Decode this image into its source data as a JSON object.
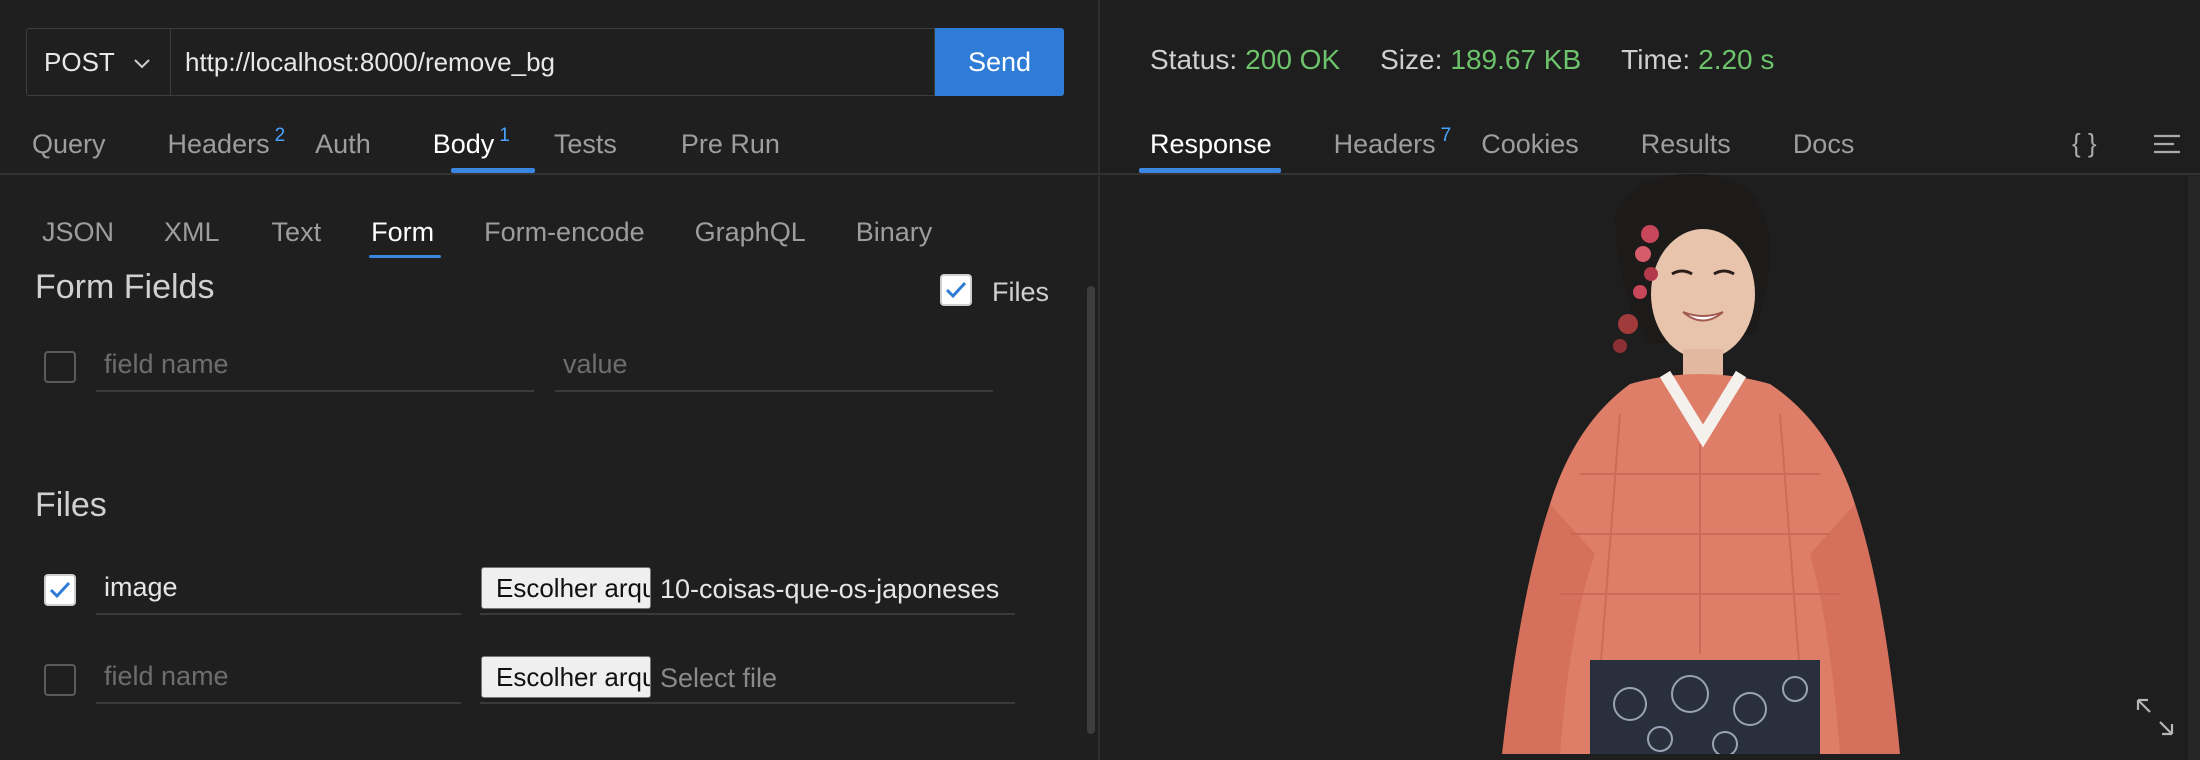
{
  "request": {
    "method": "POST",
    "url": "http://localhost:8000/remove_bg",
    "send_label": "Send",
    "tabs": [
      {
        "label": "Query",
        "badge": ""
      },
      {
        "label": "Headers",
        "badge": "2"
      },
      {
        "label": "Auth",
        "badge": ""
      },
      {
        "label": "Body",
        "badge": "1"
      },
      {
        "label": "Tests",
        "badge": ""
      },
      {
        "label": "Pre Run",
        "badge": ""
      }
    ],
    "active_tab": "Body",
    "body_tabs": [
      "JSON",
      "XML",
      "Text",
      "Form",
      "Form-encode",
      "GraphQL",
      "Binary"
    ],
    "active_body_tab": "Form",
    "form_fields": {
      "title": "Form Fields",
      "files_toggle_label": "Files",
      "files_toggle_checked": true,
      "rows": [
        {
          "checked": false,
          "name_placeholder": "field name",
          "value_placeholder": "value"
        }
      ]
    },
    "files": {
      "title": "Files",
      "rows": [
        {
          "checked": true,
          "name": "image",
          "button_label": "Escolher arquivo",
          "file_name": "10-coisas-que-os-japoneses"
        },
        {
          "checked": false,
          "name_placeholder": "field name",
          "button_label": "Escolher arquivo",
          "file_placeholder": "Select file"
        }
      ]
    }
  },
  "response": {
    "status_label": "Status:",
    "status_value": "200 OK",
    "size_label": "Size:",
    "size_value": "189.67 KB",
    "time_label": "Time:",
    "time_value": "2.20 s",
    "tabs": [
      {
        "label": "Response",
        "badge": ""
      },
      {
        "label": "Headers",
        "badge": "7"
      },
      {
        "label": "Cookies",
        "badge": ""
      },
      {
        "label": "Results",
        "badge": ""
      },
      {
        "label": "Docs",
        "badge": ""
      }
    ],
    "active_tab": "Response",
    "json_icon": "{ }",
    "image_alt": "background-removed-portrait"
  },
  "colors": {
    "accent": "#2f7cd6",
    "success": "#6cc36b",
    "badge": "#4aa3ff",
    "background": "#1f1f1f"
  },
  "icons": [
    "chevron-down-icon",
    "check-icon",
    "braces-icon",
    "menu-icon",
    "expand-icon"
  ]
}
